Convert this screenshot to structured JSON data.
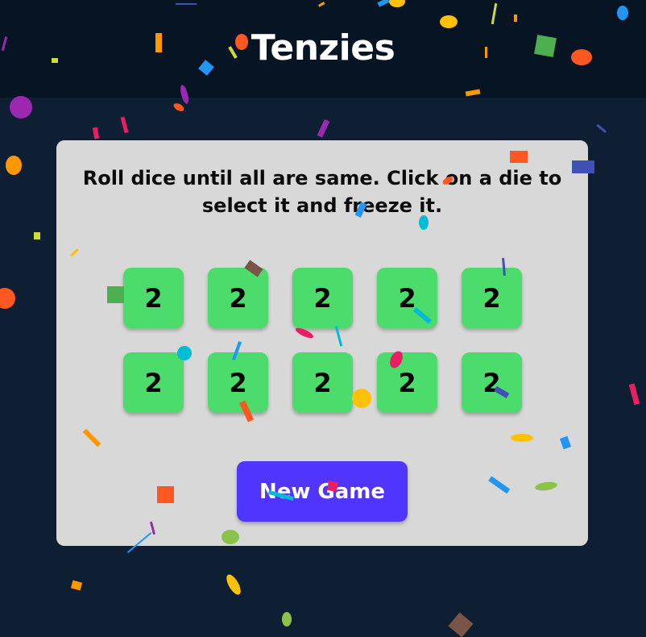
{
  "app": {
    "title": "Tenzies"
  },
  "game": {
    "instructions": "Roll dice until all are same. Click on a die to select it and freeze it.",
    "dice": [
      {
        "value": "2",
        "held": true
      },
      {
        "value": "2",
        "held": true
      },
      {
        "value": "2",
        "held": true
      },
      {
        "value": "2",
        "held": true
      },
      {
        "value": "2",
        "held": true
      },
      {
        "value": "2",
        "held": true
      },
      {
        "value": "2",
        "held": true
      },
      {
        "value": "2",
        "held": true
      },
      {
        "value": "2",
        "held": true
      },
      {
        "value": "2",
        "held": true
      }
    ],
    "button_label": "New Game"
  },
  "colors": {
    "background": "#0f1f33",
    "header": "#061423",
    "card": "#d8d8d8",
    "die_held": "#4cdc6c",
    "button": "#5035ff",
    "confetti": [
      "#ff5722",
      "#2196f3",
      "#ffc107",
      "#9c27b0",
      "#4caf50",
      "#e91e63",
      "#00bcd4",
      "#cddc39",
      "#3f51b5",
      "#795548",
      "#ff9800",
      "#8bc34a"
    ]
  }
}
